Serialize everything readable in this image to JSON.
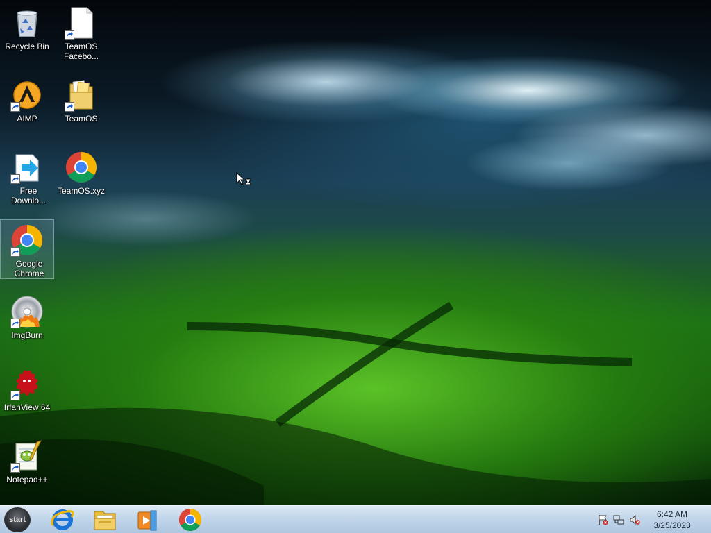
{
  "desktop": {
    "icons": [
      {
        "label": "Recycle Bin",
        "icon": "recycle-bin-icon"
      },
      {
        "label": "TeamOS Facebo...",
        "icon": "blank-document-icon"
      },
      {
        "label": "AIMP",
        "icon": "aimp-icon"
      },
      {
        "label": "TeamOS",
        "icon": "folder-icon"
      },
      {
        "label": "Free Downlo...",
        "icon": "free-download-manager-icon"
      },
      {
        "label": "TeamOS.xyz",
        "icon": "chrome-icon"
      },
      {
        "label": "Google Chrome",
        "icon": "chrome-icon"
      },
      {
        "label": "ImgBurn",
        "icon": "imgburn-disc-icon"
      },
      {
        "label": "IrfanView 64",
        "icon": "irfanview-icon"
      },
      {
        "label": "Notepad++",
        "icon": "notepad-plus-plus-icon"
      }
    ]
  },
  "taskbar": {
    "start_label": "start",
    "pinned": [
      {
        "name": "Internet Explorer",
        "icon": "internet-explorer-icon"
      },
      {
        "name": "File Explorer",
        "icon": "file-explorer-icon"
      },
      {
        "name": "Media Player",
        "icon": "media-player-icon"
      },
      {
        "name": "Google Chrome",
        "icon": "chrome-icon"
      }
    ],
    "tray": {
      "icons": [
        "action-center-flag-icon",
        "network-icon",
        "volume-muted-icon"
      ],
      "time": "6:42 AM",
      "date": "3/25/2023"
    }
  },
  "colors": {
    "taskbar_top": "#dce8f4",
    "taskbar_bottom": "#aec7e0",
    "chrome_red": "#db4437",
    "chrome_yellow": "#f4b400",
    "chrome_green": "#0f9d58",
    "chrome_blue": "#4285f4"
  }
}
